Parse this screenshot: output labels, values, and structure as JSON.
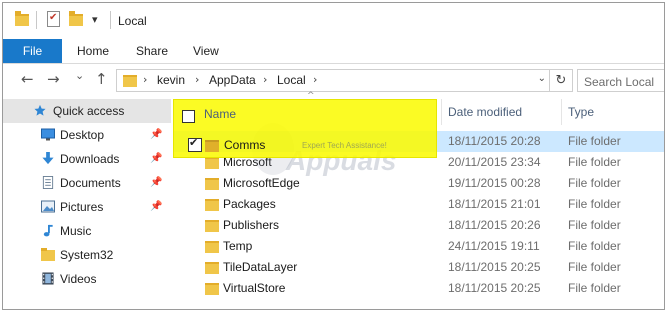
{
  "window": {
    "title": "Local",
    "qa_dropdown": "▾"
  },
  "ribbon": {
    "tabs": [
      "File",
      "Home",
      "Share",
      "View"
    ]
  },
  "nav": {
    "back": "←",
    "forward": "→",
    "recent": "⌄",
    "up": "↑"
  },
  "address": {
    "crumbs": [
      "kevin",
      "AppData",
      "Local"
    ],
    "separator": "›",
    "dropdown": "⌄",
    "refresh": "↻"
  },
  "search": {
    "placeholder": "Search Local"
  },
  "sidebar": {
    "items": [
      {
        "label": "Quick access",
        "icon": "star-icon",
        "pinned": false
      },
      {
        "label": "Desktop",
        "icon": "desktop-icon",
        "pinned": true
      },
      {
        "label": "Downloads",
        "icon": "downloads-icon",
        "pinned": true
      },
      {
        "label": "Documents",
        "icon": "documents-icon",
        "pinned": true
      },
      {
        "label": "Pictures",
        "icon": "pictures-icon",
        "pinned": true
      },
      {
        "label": "Music",
        "icon": "music-icon",
        "pinned": false
      },
      {
        "label": "System32",
        "icon": "folder-icon",
        "pinned": false
      },
      {
        "label": "Videos",
        "icon": "videos-icon",
        "pinned": false
      }
    ],
    "pin_glyph": "📌"
  },
  "columns": {
    "name": "Name",
    "date": "Date modified",
    "type": "Type",
    "sort_glyph": "^"
  },
  "files": [
    {
      "name": "Comms",
      "date": "18/11/2015 20:28",
      "type": "File folder",
      "selected": true
    },
    {
      "name": "Microsoft",
      "date": "20/11/2015 23:34",
      "type": "File folder"
    },
    {
      "name": "MicrosoftEdge",
      "date": "19/11/2015 00:28",
      "type": "File folder"
    },
    {
      "name": "Packages",
      "date": "18/11/2015 21:01",
      "type": "File folder"
    },
    {
      "name": "Publishers",
      "date": "18/11/2015 20:26",
      "type": "File folder"
    },
    {
      "name": "Temp",
      "date": "24/11/2015 19:11",
      "type": "File folder"
    },
    {
      "name": "TileDataLayer",
      "date": "18/11/2015 20:25",
      "type": "File folder"
    },
    {
      "name": "VirtualStore",
      "date": "18/11/2015 20:25",
      "type": "File folder"
    }
  ],
  "watermark": {
    "brand": "Appuals",
    "tagline": "Expert Tech Assistance!"
  },
  "colors": {
    "accent": "#1979ca",
    "selection": "#cce8ff",
    "highlight": "#fafa00",
    "folder": "#f0c649"
  }
}
